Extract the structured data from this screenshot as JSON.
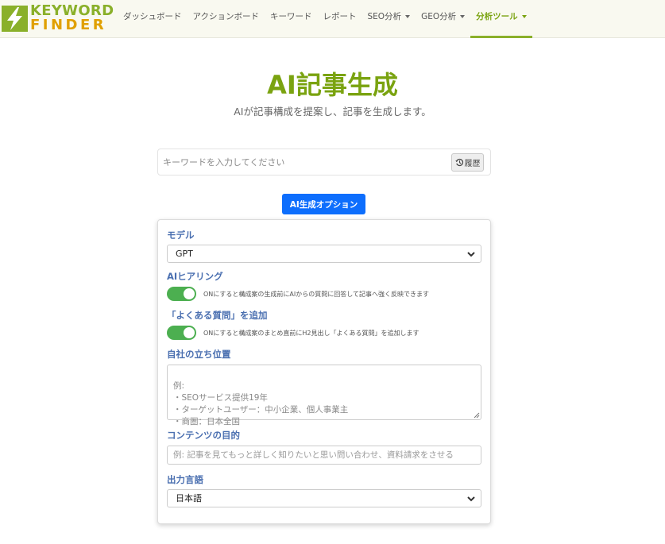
{
  "brand": {
    "line1": "KEYWORD",
    "line2": "FINDER",
    "icon": "lightning-bolt-icon",
    "colors": {
      "green": "#8ab02a",
      "yellow": "#e0a000"
    }
  },
  "nav": {
    "items": [
      {
        "label": "ダッシュボード",
        "dropdown": false
      },
      {
        "label": "アクションボード",
        "dropdown": false
      },
      {
        "label": "キーワード",
        "dropdown": false
      },
      {
        "label": "レポート",
        "dropdown": false
      },
      {
        "label": "SEO分析",
        "dropdown": true
      },
      {
        "label": "GEO分析",
        "dropdown": true
      },
      {
        "label": "分析ツール",
        "dropdown": true,
        "active": true
      }
    ]
  },
  "header": {
    "title": "AI記事生成",
    "subtitle": "AIが記事構成を提案し、記事を生成します。"
  },
  "search": {
    "placeholder": "キーワードを入力してください",
    "history_label": "履歴",
    "history_icon": "history-icon"
  },
  "options_button": {
    "label": "AI生成オプション",
    "color": "#0d6efd"
  },
  "options": {
    "model": {
      "label": "モデル",
      "value": "GPT"
    },
    "hearing": {
      "label": "AIヒアリング",
      "on": true,
      "description": "ONにすると構成案の生成前にAIからの質問に回答して記事へ強く反映できます"
    },
    "faq": {
      "label": "「よくある質問」を追加",
      "on": true,
      "description": "ONにすると構成案のまとめ直前にH2見出し「よくある質問」を追加します"
    },
    "position": {
      "label": "自社の立ち位置",
      "placeholder": "例:\n・SEOサービス提供19年\n・ターゲットユーザー：中小企業、個人事業主\n・商圏：日本全国"
    },
    "purpose": {
      "label": "コンテンツの目的",
      "placeholder": "例: 記事を見てもっと詳しく知りたいと思い問い合わせ、資料請求をさせる"
    },
    "language": {
      "label": "出力言語",
      "value": "日本語"
    }
  },
  "toggle_color": "#4caf50",
  "label_color": "#4a6fb0"
}
